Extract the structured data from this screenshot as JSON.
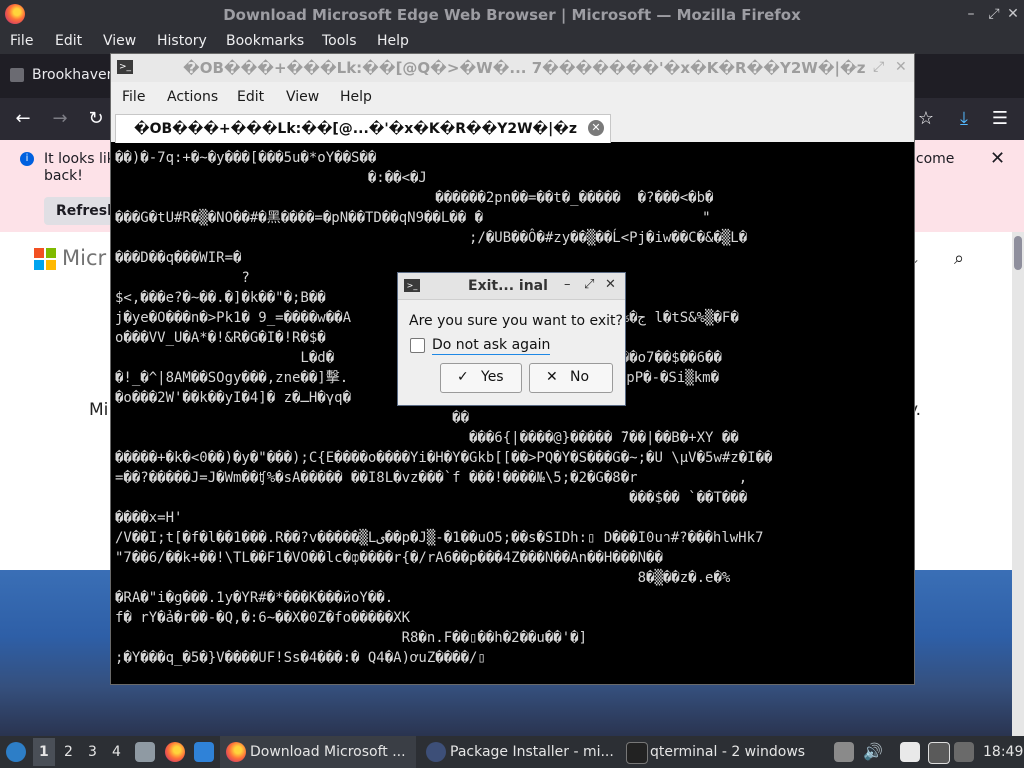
{
  "firefox": {
    "window_title": "Download Microsoft Edge Web Browser | Microsoft — Mozilla Firefox",
    "menu": [
      "File",
      "Edit",
      "View",
      "History",
      "Bookmarks",
      "Tools",
      "Help"
    ],
    "tab_title": "Brookhaven",
    "notification": {
      "text_line1": "It looks lik",
      "text_line2": "back!",
      "right_text": "lcome",
      "refresh_label": "Refresh"
    },
    "page": {
      "logo_text": "Micr",
      "side_text_left": "Mi",
      "side_text_right": "y."
    }
  },
  "qterminal": {
    "title": "�OB���+���Lk:��[@Q�>�W�...  7�������'�x�K�R��Y2W�|�z",
    "menu": [
      "File",
      "Actions",
      "Edit",
      "View",
      "Help"
    ],
    "tab_label": "�OB���+���Lk:��[@...�'�x�K�R��Y2W�|�z",
    "terminal_lines": [
      "��)�-7q:+�~�y���[���5u�*oY��S��",
      "                              �:��<�J",
      "                                      ������2pn��=��t�_�����  �?���<�b�",
      "���G�tU#R�▒�NO��#�黑����=�pN��TD��qN9��L�� �                          \"",
      "                                          ;/�UB��Ô�#zy��▒��Ĺ<Pj�iw��C�&�▒L�",
      "���D��q���WIR=�",
      "               ?",
      "$<,���e?�~��.�]�k��\"�;B��",
      "j�ye�O���n�>Pk1� 9_=����w��A                   \\�Â�pk�:�����%�ج l�tS&%▒�F�",
      "o���VV_U�A*�!&R�G�I�!R�$�",
      "                      L�d�                    �Y�.ăCx���F��Y��o7��$��6��",
      "�!_�^|8AM��SOgy���,zne��]擊.                  �g\\7.���]L��+8�pP�-�Si▒km�",
      "�o���2W'��k��yI�4]� z�ـH�γq�",
      "                                        ��",
      "                                          ���6{|����@}����� ̆7��|��B�+XY ��",
      "�����+�k�<0��)�y�\"���);C{E����o����Yi�H�Y�Gkb[[��>PQ�Y�S���G�~;�U \\µV�5w#z�I��",
      "=��?�����J=J�Wm��ʧ%�sA����� ��I8L�vz���`f ���!����№\\5;�2�G�8�r            ,",
      "                                                             ���$�� `��T���",
      "����x=H'",
      "/V��I;t[�f�l��1���.R��?v�����▒Lی��p�J▒-�1��uO5;��s�SIDh:▯ D���I0uา#?���hlwHk7",
      "\"7��6/��k+��!\\TL��F1�VO��lc�ȹ����r{�/rA6��p���4Z���N��An��H���N��",
      "                                                              8�▒��z�.e�%",
      "�RA�\"i�g���.1y�YR#�*���K���йoY��.",
      "f� rY�ả�r��-�Q,�:6~��X�0Z�fo�����XK",
      "                                  R8�n.Ϝ��▯��h�2��u��'�]",
      ";�Y���q_�5�}V����UF!Ss�4���:� Q4�A)ơuZ����/▯"
    ]
  },
  "dialog": {
    "title": "Exit...  inal",
    "question": "Are you sure you want to exit?",
    "checkbox_label": "Do not ask again",
    "checkbox_checked": false,
    "yes_label": "Yes",
    "no_label": "No"
  },
  "taskbar": {
    "workspaces": [
      "1",
      "2",
      "3",
      "4"
    ],
    "items": [
      {
        "label": "Download Microsoft ..."
      },
      {
        "label": "Package Installer - mi..."
      },
      {
        "label": "qterminal - 2 windows"
      }
    ],
    "clock": "18:49"
  }
}
